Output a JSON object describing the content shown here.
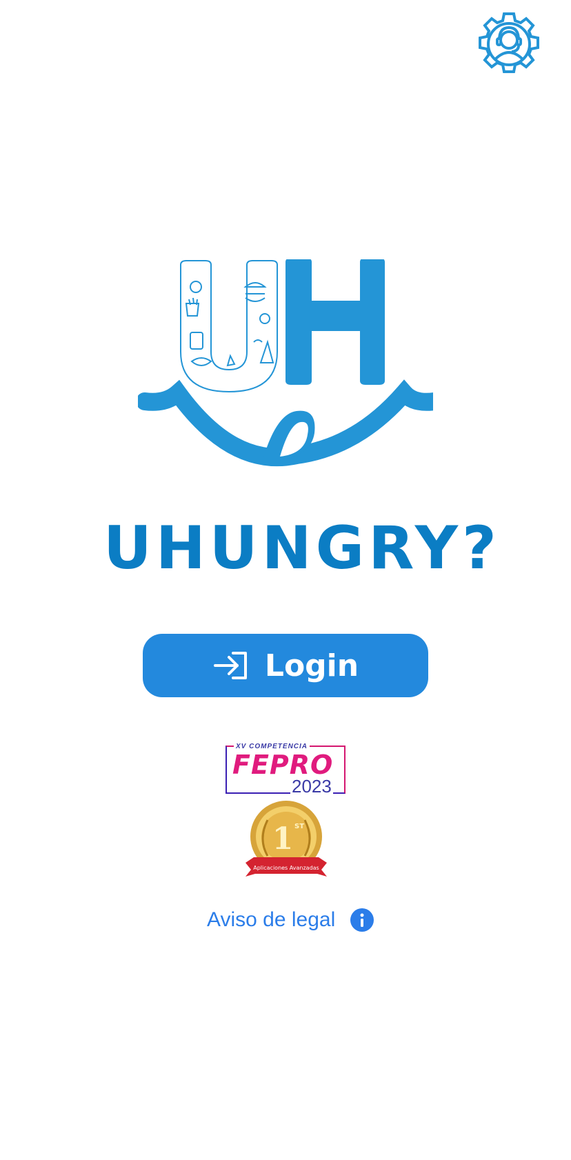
{
  "app": {
    "wordmark": "UHUNGRY?",
    "login_label": "Login",
    "legal_label": "Aviso de legal"
  },
  "award": {
    "line1": "XV COMPETENCIA",
    "line2": "FEPRO",
    "line3": "2023",
    "medal_place": "1",
    "medal_suffix": "ST",
    "medal_ribbon": "Aplicaciones Avanzadas"
  },
  "icons": {
    "support": "gear-support-icon",
    "login": "login-arrow-icon",
    "info": "info-circle-icon"
  },
  "colors": {
    "brand_blue": "#2495d6",
    "wordmark_blue": "#0b7dc4",
    "button_blue": "#2389dd",
    "link_blue": "#2b7de9"
  }
}
